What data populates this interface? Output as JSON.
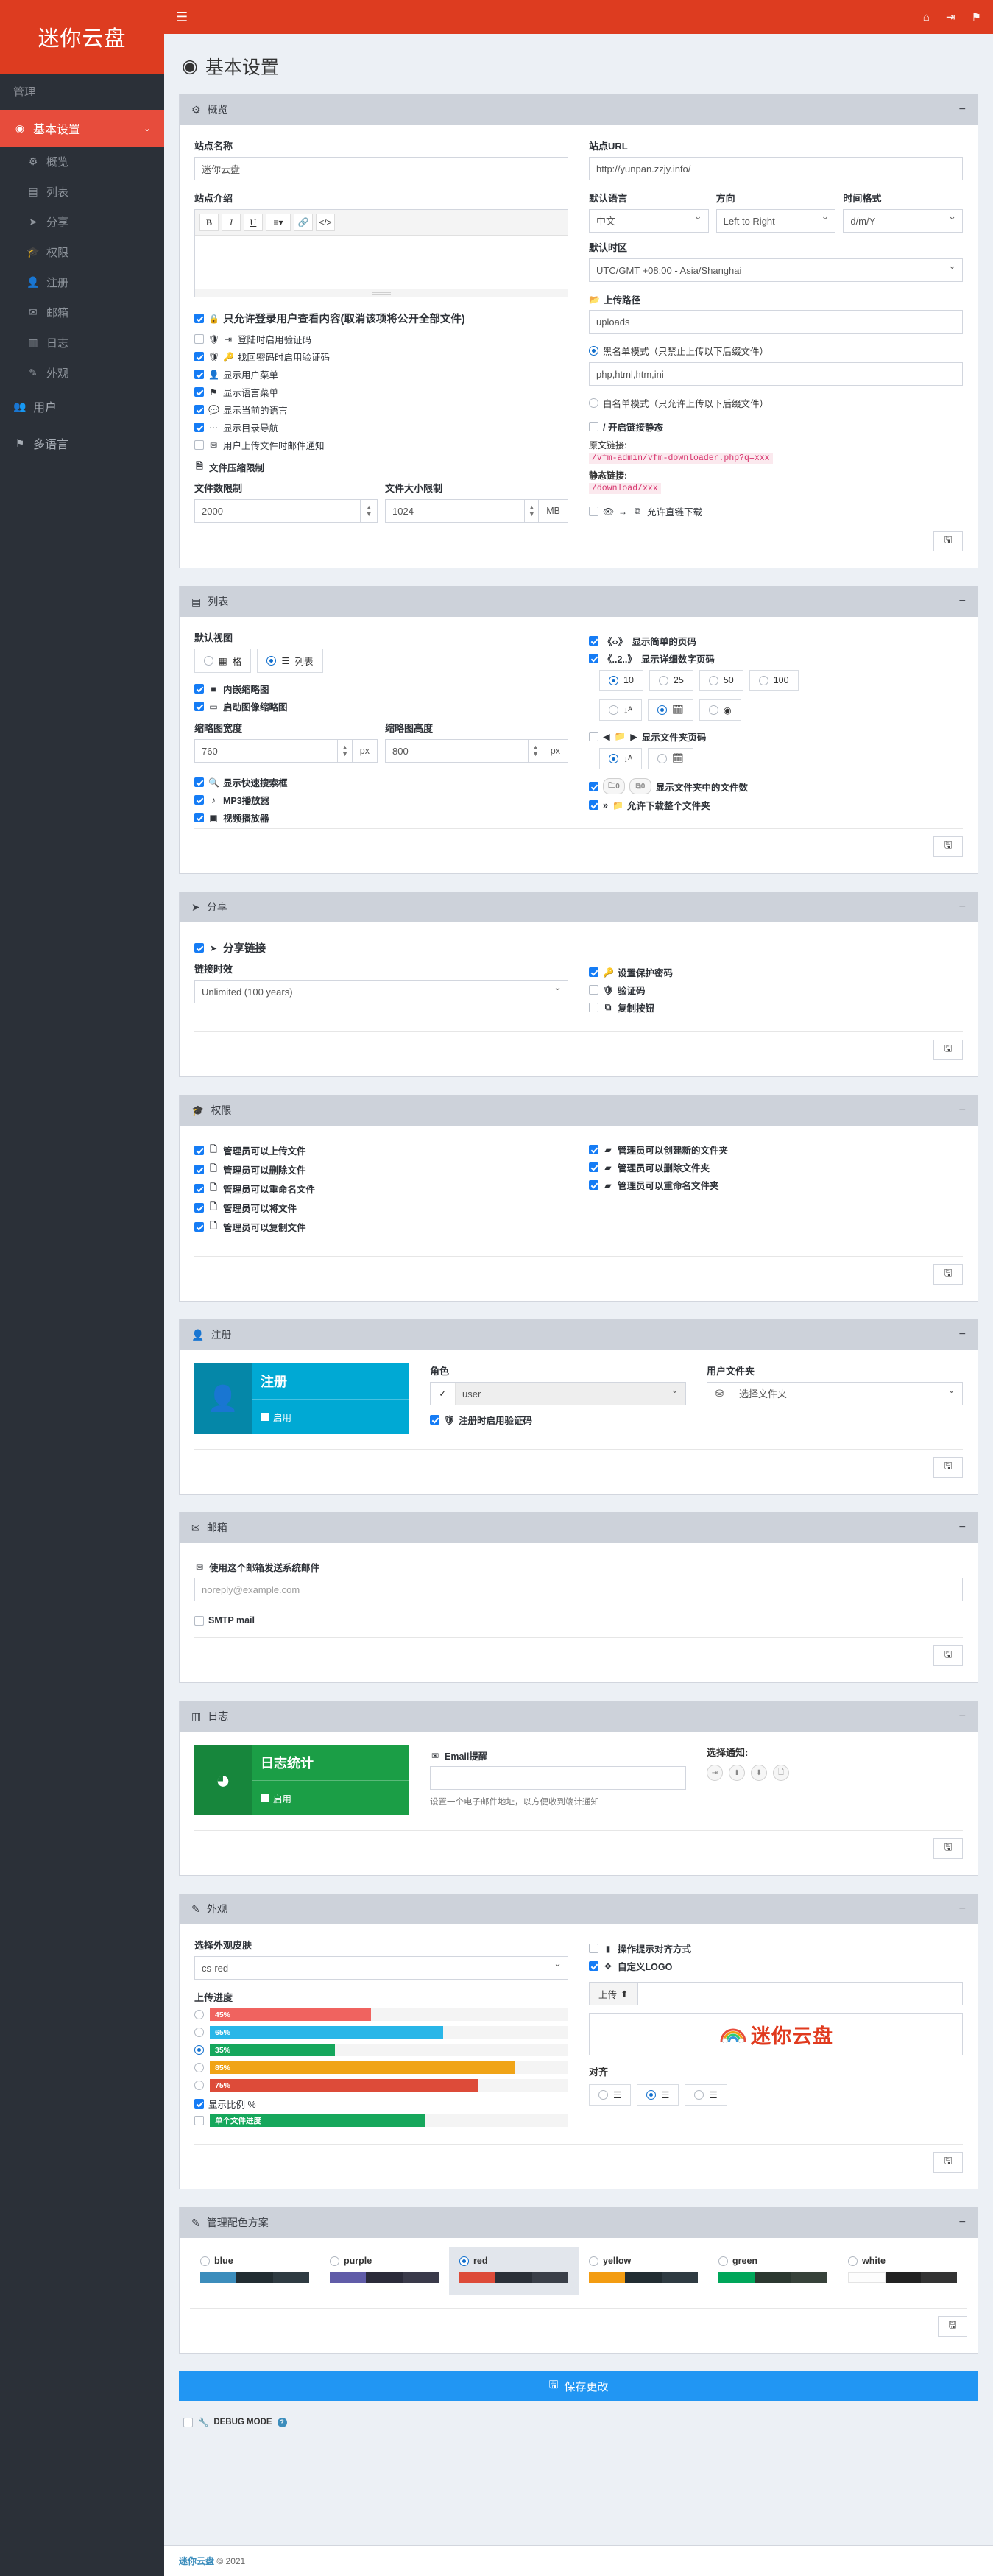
{
  "brand": {
    "title": "迷你云盘"
  },
  "topbar": {
    "hamburger": "menu-icon",
    "icons": [
      "home-icon",
      "logout-icon",
      "flag-icon"
    ]
  },
  "sidebar": {
    "section_label": "管理",
    "active_item": {
      "label": "基本设置",
      "icon": "dashboard-icon"
    },
    "sub_items": [
      {
        "label": "概览",
        "icon": "gears-icon"
      },
      {
        "label": "列表",
        "icon": "list-icon"
      },
      {
        "label": "分享",
        "icon": "share-icon"
      },
      {
        "label": "权限",
        "icon": "graduation-icon"
      },
      {
        "label": "注册",
        "icon": "user-plus-icon"
      },
      {
        "label": "邮箱",
        "icon": "envelope-icon"
      },
      {
        "label": "日志",
        "icon": "chart-icon"
      },
      {
        "label": "外观",
        "icon": "brush-icon"
      }
    ],
    "other_items": [
      {
        "label": "用户",
        "icon": "users-icon"
      },
      {
        "label": "多语言",
        "icon": "flag-icon"
      }
    ]
  },
  "page": {
    "title": "基本设置",
    "icon": "dashboard-icon"
  },
  "overview": {
    "panel_title": "概览",
    "site_name_label": "站点名称",
    "site_name_value": "迷你云盘",
    "site_desc_label": "站点介绍",
    "editor_buttons": [
      "B",
      "I",
      "U",
      "≡",
      "link",
      "</>"
    ],
    "site_url_label": "站点URL",
    "site_url_value": "http://yunpan.zzjy.info/",
    "default_lang_label": "默认语言",
    "default_lang_value": "中文",
    "direction_label": "方向",
    "direction_value": "Left to Right",
    "time_format_label": "时间格式",
    "time_format_value": "d/m/Y",
    "timezone_label": "默认时区",
    "timezone_value": "UTC/GMT +08:00 - Asia/Shanghai",
    "checkboxes": [
      {
        "label": "只允许登录用户查看内容(取消该项将公开全部文件)",
        "checked": true,
        "icon": "lock-icon",
        "big": true
      },
      {
        "label": "登陆时启用验证码",
        "checked": false,
        "icon": "shield-signin-icon"
      },
      {
        "label": "找回密码时启用验证码",
        "checked": true,
        "icon": "shield-key-icon"
      },
      {
        "label": "显示用户菜单",
        "checked": true,
        "icon": "user-icon"
      },
      {
        "label": "显示语言菜单",
        "checked": true,
        "icon": "flag-icon"
      },
      {
        "label": "显示当前的语言",
        "checked": true,
        "icon": "comment-icon"
      },
      {
        "label": "显示目录导航",
        "checked": true,
        "icon": "dots-icon"
      },
      {
        "label": "用户上传文件时邮件通知",
        "checked": false,
        "icon": "envelope-icon"
      }
    ],
    "compress_limit_title": "文件压缩限制",
    "file_count_label": "文件数限制",
    "file_count_value": "2000",
    "file_size_label": "文件大小限制",
    "file_size_value": "1024",
    "file_size_unit": "MB",
    "upload_path_label": "上传路径",
    "upload_path_value": "uploads",
    "blacklist_label": "黑名单模式（只禁止上传以下后缀文件）",
    "blacklist_checked": true,
    "blacklist_value": "php,html,htm,ini",
    "whitelist_label": "白名单模式（只允许上传以下后缀文件）",
    "whitelist_checked": false,
    "static_link_label": "/ 开启链接静态",
    "static_link_checked": false,
    "original_link_label": "原文链接:",
    "original_link_value": "/vfm-admin/vfm-downloader.php?q=xxx",
    "static_link_text_label": "静态链接:",
    "static_link_value": "/download/xxx",
    "direct_download_label": "允许直链下载",
    "direct_download_checked": false
  },
  "list": {
    "panel_title": "列表",
    "default_view_label": "默认视图",
    "view_options": [
      {
        "label": "格",
        "selected": false,
        "icon": "grid-icon"
      },
      {
        "label": "列表",
        "selected": true,
        "icon": "list-icon"
      }
    ],
    "checkboxes": [
      {
        "label": "内嵌缩略图",
        "checked": true,
        "icon": "square-icon"
      },
      {
        "label": "启动图像缩略图",
        "checked": true,
        "icon": "image-icon"
      }
    ],
    "thumb_width_label": "缩略图宽度",
    "thumb_width_value": "760",
    "thumb_height_label": "缩略图高度",
    "thumb_height_value": "800",
    "unit": "px",
    "checkboxes2": [
      {
        "label": "显示快速搜索框",
        "checked": true,
        "icon": "search-icon"
      },
      {
        "label": "MP3播放器",
        "checked": true,
        "icon": "music-icon"
      },
      {
        "label": "视频播放器",
        "checked": true,
        "icon": "video-icon"
      }
    ],
    "simple_pager_label": "显示简单的页码",
    "simple_pager_prefix": "《‹›》",
    "simple_pager_checked": true,
    "detail_pager_label": "显示详细数字页码",
    "detail_pager_prefix": "《..2..》",
    "detail_pager_checked": true,
    "per_page": [
      "10",
      "25",
      "50",
      "100"
    ],
    "per_page_selected": "10",
    "sort_options": [
      {
        "icon": "sort-alpha-icon",
        "selected": false
      },
      {
        "icon": "calendar-icon",
        "selected": true
      },
      {
        "icon": "dashboard-icon",
        "selected": false
      }
    ],
    "folder_pager_label": "显示文件夹页码",
    "folder_pager_prefix": "◀▶",
    "folder_pager_checked": false,
    "folder_sort_options": [
      {
        "icon": "sort-alpha-icon",
        "selected": true
      },
      {
        "icon": "calendar-icon",
        "selected": false
      }
    ],
    "file_count_label": "显示文件夹中的文件数",
    "file_count_checked": true,
    "file_count_badges": [
      "0",
      "0"
    ],
    "download_folder_label": "允许下载整个文件夹",
    "download_folder_prefix": "»",
    "download_folder_checked": true
  },
  "share": {
    "panel_title": "分享",
    "share_link_label": "分享链接",
    "share_link_checked": true,
    "duration_label": "链接时效",
    "duration_value": "Unlimited (100 years)",
    "options": [
      {
        "label": "设置保护密码",
        "checked": true,
        "icon": "key-icon"
      },
      {
        "label": "验证码",
        "checked": false,
        "icon": "shield-icon"
      },
      {
        "label": "复制按钮",
        "checked": false,
        "icon": "copy-icon"
      }
    ]
  },
  "permissions": {
    "panel_title": "权限",
    "left": [
      {
        "label": "管理员可以上传文件",
        "checked": true,
        "icon": "file-upload-icon"
      },
      {
        "label": "管理员可以删除文件",
        "checked": true,
        "icon": "file-delete-icon"
      },
      {
        "label": "管理员可以重命名文件",
        "checked": true,
        "icon": "file-rename-icon"
      },
      {
        "label": "管理员可以将文件",
        "checked": true,
        "icon": "file-move-icon"
      },
      {
        "label": "管理员可以复制文件",
        "checked": true,
        "icon": "file-copy-icon"
      }
    ],
    "right": [
      {
        "label": "管理员可以创建新的文件夹",
        "checked": true,
        "icon": "folder-add-icon"
      },
      {
        "label": "管理员可以删除文件夹",
        "checked": true,
        "icon": "folder-delete-icon"
      },
      {
        "label": "管理员可以重命名文件夹",
        "checked": true,
        "icon": "folder-rename-icon"
      }
    ]
  },
  "register": {
    "panel_title": "注册",
    "tile_title": "注册",
    "tile_toggle": "启用",
    "role_label": "角色",
    "role_value": "user",
    "user_folder_label": "用户文件夹",
    "user_folder_value": "选择文件夹",
    "captcha_label": "注册时启用验证码",
    "captcha_checked": true
  },
  "mail": {
    "panel_title": "邮箱",
    "use_mail_label": "使用这个邮箱发送系统邮件",
    "mail_placeholder": "noreply@example.com",
    "smtp_label": "SMTP mail",
    "smtp_checked": false
  },
  "log": {
    "panel_title": "日志",
    "tile_title": "日志统计",
    "tile_toggle": "启用",
    "email_alert_label": "Email提醒",
    "email_value": "",
    "hint": "设置一个电子邮件地址，以方便收到端计通知",
    "notify_label": "选择通知:",
    "notify_icons": [
      "signin-icon",
      "upload-icon",
      "download-icon",
      "file-icon"
    ]
  },
  "appearance": {
    "panel_title": "外观",
    "skin_label": "选择外观皮肤",
    "skin_value": "cs-red",
    "upload_progress_label": "上传进度",
    "progress_options": [
      {
        "percent": "45%",
        "value": 45,
        "color": "#f0635f",
        "selected": false,
        "striped": true
      },
      {
        "percent": "65%",
        "value": 65,
        "color": "#29b6e8",
        "selected": false,
        "striped": true
      },
      {
        "percent": "35%",
        "value": 35,
        "color": "#16a75c",
        "selected": true,
        "striped": false
      },
      {
        "percent": "85%",
        "value": 85,
        "color": "#f0a417",
        "selected": false,
        "striped": true
      },
      {
        "percent": "75%",
        "value": 75,
        "color": "#dd4b39",
        "selected": false,
        "striped": true
      }
    ],
    "show_percent_label": "显示比例 %",
    "show_percent_checked": true,
    "single_file_label": "单个文件进度",
    "single_file_checked": false,
    "single_file_value": 60,
    "single_file_color": "#16a75c",
    "tooltip_align_label": "操作提示对齐方式",
    "tooltip_align_checked": false,
    "custom_logo_label": "自定义LOGO",
    "custom_logo_checked": true,
    "upload_btn_label": "上传",
    "logo_text": "迷你云盘",
    "align_label": "对齐",
    "align_options": [
      {
        "icon": "align-left-icon",
        "selected": false
      },
      {
        "icon": "align-center-icon",
        "selected": true
      },
      {
        "icon": "align-right-icon",
        "selected": false
      }
    ]
  },
  "color_schemes": {
    "panel_title": "管理配色方案",
    "items": [
      {
        "name": "blue",
        "selected": false,
        "colors": [
          "#3c8dbc",
          "#222d32",
          "#2f3b42"
        ]
      },
      {
        "name": "purple",
        "selected": false,
        "colors": [
          "#605ca8",
          "#2b2b3a",
          "#3a3a4a"
        ]
      },
      {
        "name": "red",
        "selected": true,
        "colors": [
          "#dd4b39",
          "#2b3038",
          "#3a3f48"
        ]
      },
      {
        "name": "yellow",
        "selected": false,
        "colors": [
          "#f39c12",
          "#222d32",
          "#2f3b42"
        ]
      },
      {
        "name": "green",
        "selected": false,
        "colors": [
          "#00a65a",
          "#2b3830",
          "#37423a"
        ]
      },
      {
        "name": "white",
        "selected": false,
        "colors": [
          "#fdfdfd",
          "#222222",
          "#333333"
        ]
      }
    ]
  },
  "footer_actions": {
    "save_label": "保存更改",
    "save_icon": "save-icon",
    "debug_label": "DEBUG MODE",
    "debug_checked": false
  },
  "footer": {
    "brand": "迷你云盘",
    "copyright": "© 2021"
  }
}
